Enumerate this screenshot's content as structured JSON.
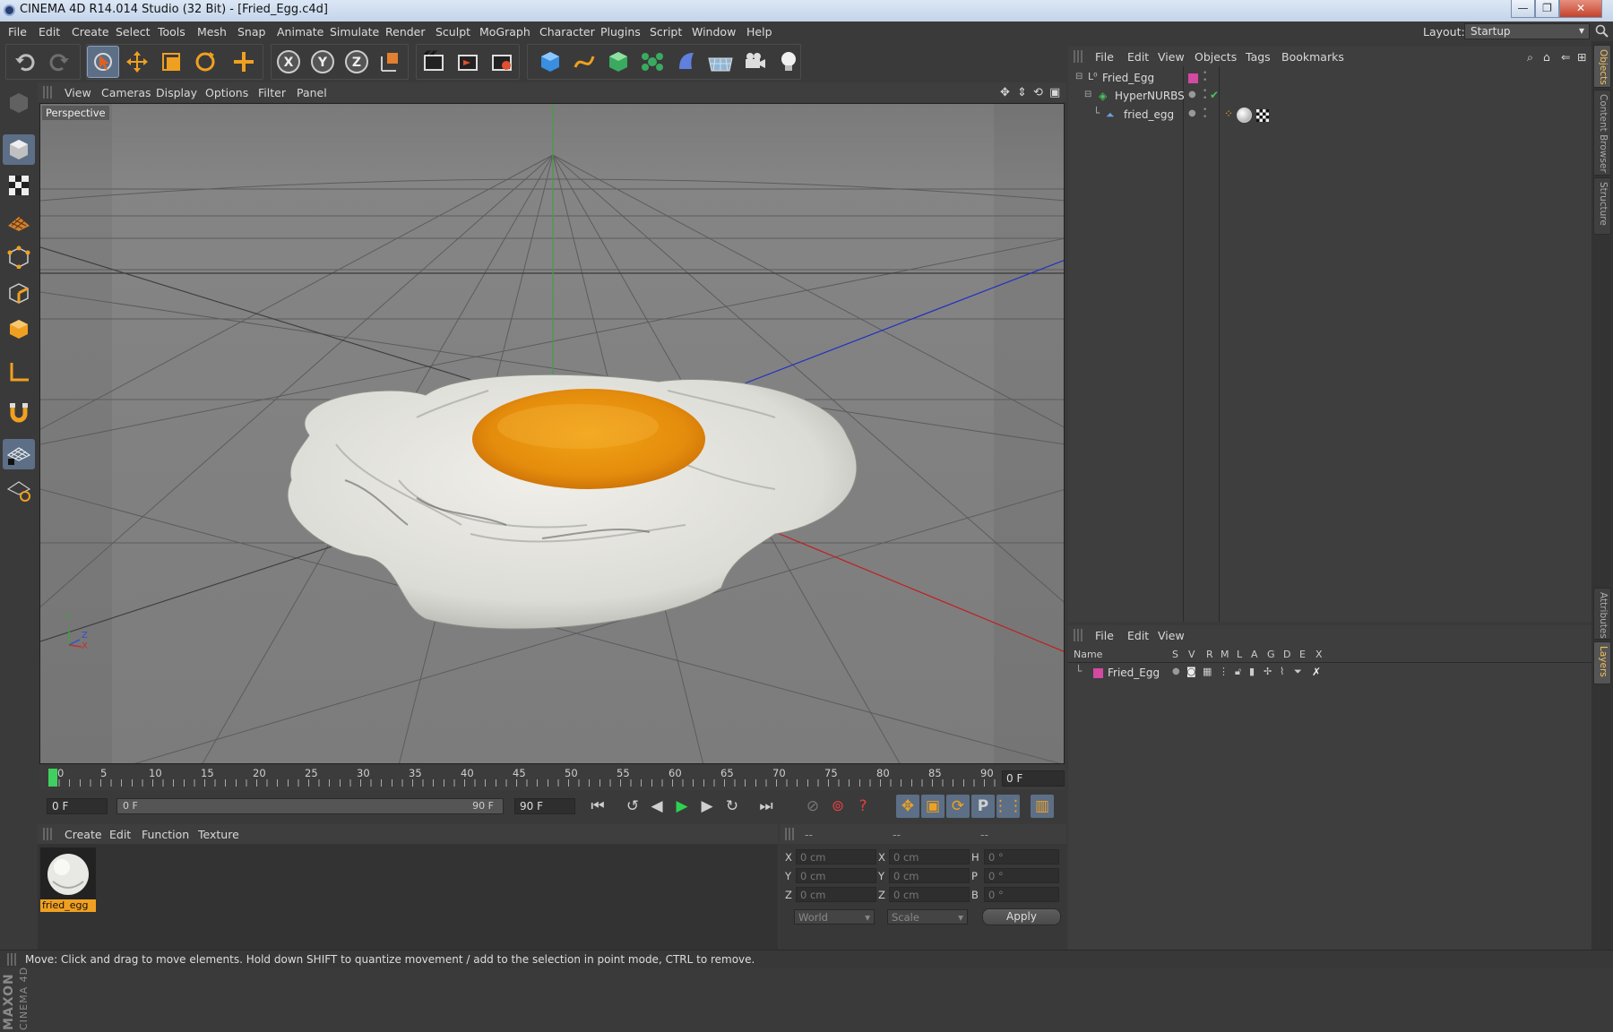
{
  "window": {
    "title": "CINEMA 4D R14.014 Studio (32 Bit) - [Fried_Egg.c4d]",
    "min": "—",
    "max": "❐",
    "close": "✕"
  },
  "menu": [
    "File",
    "Edit",
    "Create",
    "Select",
    "Tools",
    "Mesh",
    "Snap",
    "Animate",
    "Simulate",
    "Render",
    "Sculpt",
    "MoGraph",
    "Character",
    "Plugins",
    "Script",
    "Window",
    "Help"
  ],
  "layout": {
    "label": "Layout:",
    "value": "Startup"
  },
  "viewport": {
    "menu": [
      "View",
      "Cameras",
      "Display",
      "Options",
      "Filter",
      "Panel"
    ],
    "label": "Perspective",
    "axis_labels": {
      "y": "Y",
      "z": "Z",
      "x": "X"
    }
  },
  "timeline": {
    "ticks": [
      "0",
      "5",
      "10",
      "15",
      "20",
      "25",
      "30",
      "35",
      "40",
      "45",
      "50",
      "55",
      "60",
      "65",
      "70",
      "75",
      "80",
      "85",
      "90"
    ],
    "current": "0 F"
  },
  "transport": {
    "start": "0 F",
    "range_start": "0 F",
    "range_end": "90 F",
    "end": "90 F"
  },
  "materials": {
    "menu": [
      "Create",
      "Edit",
      "Function",
      "Texture"
    ],
    "items": [
      {
        "name": "fried_egg"
      }
    ]
  },
  "coords": {
    "header": [
      "--",
      "--",
      "--"
    ],
    "rows": [
      {
        "a": "X",
        "av": "0 cm",
        "b": "X",
        "bv": "0 cm",
        "c": "H",
        "cv": "0 °"
      },
      {
        "a": "Y",
        "av": "0 cm",
        "b": "Y",
        "bv": "0 cm",
        "c": "P",
        "cv": "0 °"
      },
      {
        "a": "Z",
        "av": "0 cm",
        "b": "Z",
        "bv": "0 cm",
        "c": "B",
        "cv": "0 °"
      }
    ],
    "mode1": "World",
    "mode2": "Scale",
    "apply": "Apply"
  },
  "objects": {
    "menu": [
      "File",
      "Edit",
      "View",
      "Objects",
      "Tags",
      "Bookmarks"
    ],
    "tree": [
      {
        "name": "Fried_Egg",
        "color": "#d24aa2"
      },
      {
        "name": "HyperNURBS"
      },
      {
        "name": "fried_egg"
      }
    ]
  },
  "layers": {
    "menu": [
      "File",
      "Edit",
      "View"
    ],
    "columns": [
      "Name",
      "S",
      "V",
      "R",
      "M",
      "L",
      "A",
      "G",
      "D",
      "E",
      "X"
    ],
    "rows": [
      {
        "name": "Fried_Egg",
        "color": "#d24aa2"
      }
    ]
  },
  "side_tabs": [
    "Objects",
    "Content Browser",
    "Structure",
    "Attributes",
    "Layers"
  ],
  "brand": {
    "line1": "MAXON",
    "line2": "CINEMA 4D"
  },
  "status": "Move: Click and drag to move elements. Hold down SHIFT to quantize movement / add to the selection in point mode, CTRL to remove."
}
